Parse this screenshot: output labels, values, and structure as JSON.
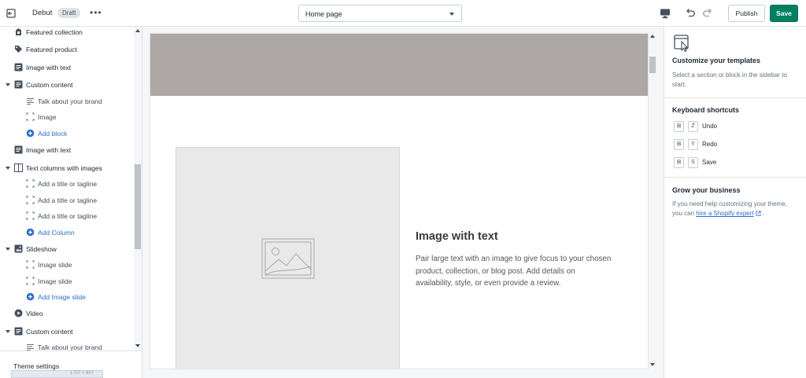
{
  "topbar": {
    "theme_name": "Debut",
    "badge": "Draft",
    "more": "•••",
    "page_select": "Home page",
    "publish": "Publish",
    "save": "Save"
  },
  "sidebar": {
    "items": [
      {
        "label": "Featured collection",
        "icon": "collection-icon",
        "level": 0
      },
      {
        "label": "Featured product",
        "icon": "tag-icon",
        "level": 0
      },
      {
        "label": "Image with text",
        "icon": "text-block-icon",
        "level": 0
      },
      {
        "label": "Custom content",
        "icon": "text-block-icon",
        "level": 0,
        "expanded": true
      },
      {
        "label": "Talk about your brand",
        "icon": "text-lines-icon",
        "level": 1
      },
      {
        "label": "Image",
        "icon": "image-frame-icon",
        "level": 1
      },
      {
        "label": "Add block",
        "icon": "plus-circle-icon",
        "level": 1,
        "add": true
      },
      {
        "label": "Image with text",
        "icon": "text-block-icon",
        "level": 0
      },
      {
        "label": "Text columns with images",
        "icon": "columns-icon",
        "level": 0,
        "expanded": true
      },
      {
        "label": "Add a title or tagline",
        "icon": "image-frame-icon",
        "level": 1
      },
      {
        "label": "Add a title or tagline",
        "icon": "image-frame-icon",
        "level": 1
      },
      {
        "label": "Add a title or tagline",
        "icon": "image-frame-icon",
        "level": 1
      },
      {
        "label": "Add Column",
        "icon": "plus-circle-icon",
        "level": 1,
        "add": true
      },
      {
        "label": "Slideshow",
        "icon": "slideshow-icon",
        "level": 0,
        "expanded": true
      },
      {
        "label": "Image slide",
        "icon": "image-frame-icon",
        "level": 1
      },
      {
        "label": "Image slide",
        "icon": "image-frame-icon",
        "level": 1
      },
      {
        "label": "Add Image slide",
        "icon": "plus-circle-icon",
        "level": 1,
        "add": true
      },
      {
        "label": "Video",
        "icon": "play-icon",
        "level": 0
      },
      {
        "label": "Custom content",
        "icon": "text-block-icon",
        "level": 0,
        "expanded": true
      },
      {
        "label": "Talk about your brand",
        "icon": "text-lines-icon",
        "level": 1
      }
    ],
    "theme_settings": "Theme settings",
    "dimension_readout": "1707 × 807"
  },
  "preview": {
    "heading": "Image with text",
    "body": "Pair large text with an image to give focus to your chosen product, collection, or blog post. Add details on availability, style, or even provide a review."
  },
  "right_panel": {
    "customize_title": "Customize your templates",
    "customize_desc": "Select a section or block in the sidebar to start.",
    "shortcuts_title": "Keyboard shortcuts",
    "shortcuts": [
      {
        "key": "Z",
        "label": "Undo"
      },
      {
        "key": "Y",
        "label": "Redo"
      },
      {
        "key": "S",
        "label": "Save"
      }
    ],
    "grow_title": "Grow your business",
    "grow_text_1": "If you need help customizing your theme, you can",
    "grow_link": "hire a Shopify expert",
    "grow_text_2": "."
  },
  "colors": {
    "save_button": "#008060",
    "link": "#2c6ecb",
    "banner": "#ada8a5"
  }
}
